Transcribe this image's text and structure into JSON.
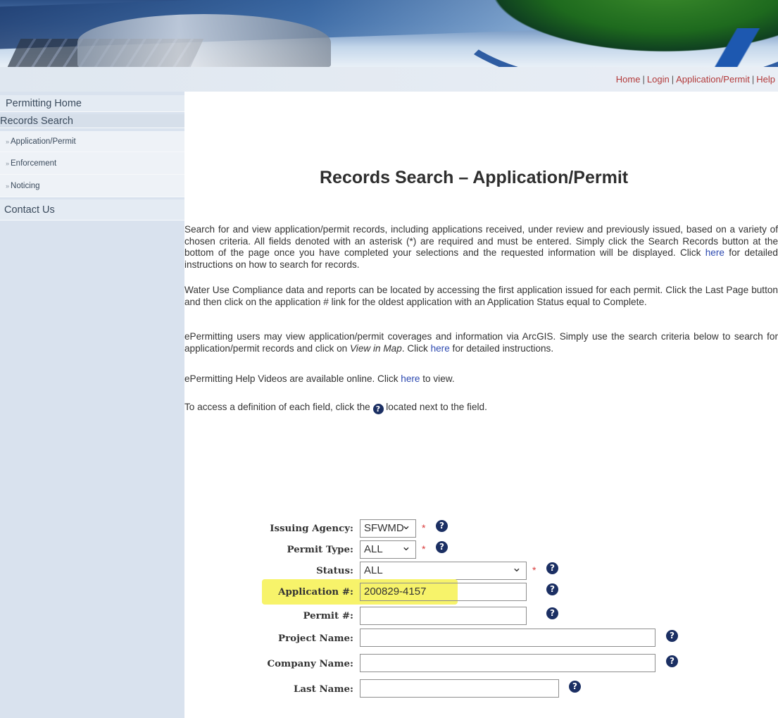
{
  "topnav": {
    "home": "Home",
    "login": "Login",
    "application_permit": "Application/Permit",
    "help": "Help",
    "separator": "|"
  },
  "sidebar": {
    "items": [
      {
        "label": "Permitting Home"
      },
      {
        "label": "Records Search"
      },
      {
        "label": "Application/Permit",
        "arrow": "»"
      },
      {
        "label": "Enforcement",
        "arrow": "»"
      },
      {
        "label": "Noticing",
        "arrow": "»"
      },
      {
        "label": "Contact Us"
      }
    ]
  },
  "main": {
    "title": "Records Search – Application/Permit",
    "para1": "Search for and view application/permit records, including applications received, under review and previously issued, based on a variety of chosen criteria.  All fields denoted with an asterisk (*) are required and must be entered.  Simply click the Search Records button at the bottom of the page once you have completed your selections and the requested information will be displayed. Click ",
    "para1_link": "here",
    "para1_end": " for detailed instructions on how to search for records.",
    "para2": "Water Use Compliance data and reports can be located by accessing the first application issued for each permit.  Click the Last Page button and then click on the application # link for the oldest application with an Application Status equal to Complete.",
    "para3_a": "ePermitting users may view application/permit coverages and information via ArcGIS. Simply use the search criteria below to search for application/permit records and click on ",
    "para3_italic": "View in Map",
    "para3_b": ".  Click ",
    "para3_link": "here",
    "para3_end": " for detailed instructions.",
    "para4_a": "ePermitting Help Videos are available online.  Click ",
    "para4_link": "here",
    "para4_end": " to view.",
    "para5_a": "To access a definition of each field, click the ",
    "para5_end": " located next to the field."
  },
  "form": {
    "issuing_agency": {
      "label": "Issuing Agency:",
      "value": "SFWMD"
    },
    "permit_type": {
      "label": "Permit Type:",
      "value": "ALL"
    },
    "status": {
      "label": "Status:",
      "value": "ALL"
    },
    "application_no": {
      "label": "Application #:",
      "value": "200829-4157"
    },
    "permit_no": {
      "label": "Permit #:",
      "value": ""
    },
    "project_name": {
      "label": "Project Name:",
      "value": ""
    },
    "company_name": {
      "label": "Company Name:",
      "value": ""
    },
    "last_name": {
      "label": "Last Name:",
      "value": ""
    },
    "required_mark": "*",
    "help_glyph": "?"
  },
  "colors": {
    "highlight": "#f7f36a",
    "link": "#2c49b0",
    "topnav_link": "#b23a3a",
    "help_icon": "#1b2f63",
    "required": "#d83b3b"
  }
}
